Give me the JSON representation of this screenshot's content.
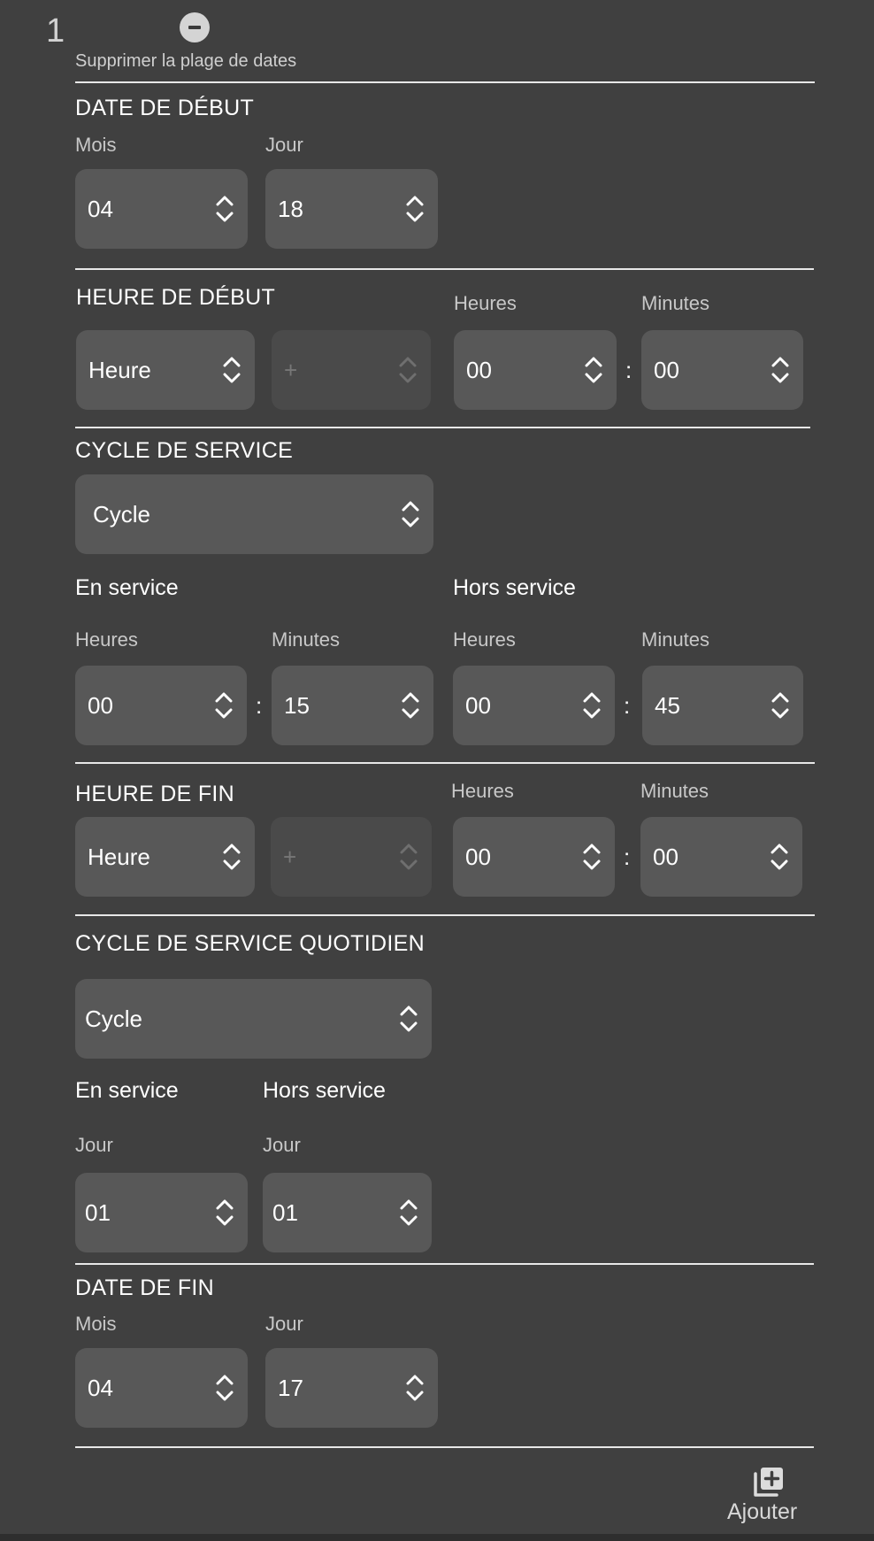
{
  "range": {
    "index": "1",
    "remove_label": "Supprimer la plage de dates"
  },
  "start_date": {
    "title": "DATE DE DÉBUT",
    "month_label": "Mois",
    "month_value": "04",
    "day_label": "Jour",
    "day_value": "18"
  },
  "start_time": {
    "title": "HEURE DE DÉBUT",
    "mode_value": "Heure",
    "offset_value": "+",
    "hours_label": "Heures",
    "hours_value": "00",
    "minutes_label": "Minutes",
    "minutes_value": "00"
  },
  "duty_cycle": {
    "title": "CYCLE DE SERVICE",
    "mode_value": "Cycle",
    "on_label": "En service",
    "off_label": "Hors service",
    "on_hours_label": "Heures",
    "on_hours_value": "00",
    "on_minutes_label": "Minutes",
    "on_minutes_value": "15",
    "off_hours_label": "Heures",
    "off_hours_value": "00",
    "off_minutes_label": "Minutes",
    "off_minutes_value": "45"
  },
  "end_time": {
    "title": "HEURE DE FIN",
    "mode_value": "Heure",
    "offset_value": "+",
    "hours_label": "Heures",
    "hours_value": "00",
    "minutes_label": "Minutes",
    "minutes_value": "00"
  },
  "daily_cycle": {
    "title": "CYCLE DE SERVICE QUOTIDIEN",
    "mode_value": "Cycle",
    "on_label": "En service",
    "off_label": "Hors service",
    "on_day_label": "Jour",
    "on_day_value": "01",
    "off_day_label": "Jour",
    "off_day_value": "01"
  },
  "end_date": {
    "title": "DATE DE FIN",
    "month_label": "Mois",
    "month_value": "04",
    "day_label": "Jour",
    "day_value": "17"
  },
  "actions": {
    "add_label": "Ajouter"
  },
  "icons": {
    "remove": "minus-circle-icon",
    "spinner": "chevron-up-down-icon",
    "add": "add-stack-icon"
  },
  "colors": {
    "background": "#404040",
    "field": "#585858",
    "field_disabled": "#4a4a4a",
    "divider": "#e8e8e8"
  }
}
